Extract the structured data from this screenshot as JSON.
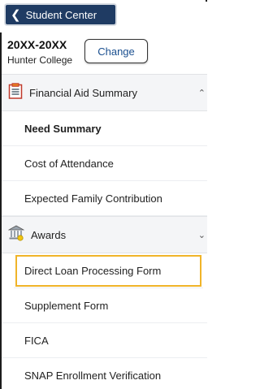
{
  "header": {
    "back_label": "Student Center"
  },
  "term": {
    "title": "20XX-20XX",
    "college": "Hunter College",
    "change_label": "Change"
  },
  "sections": [
    {
      "label": "Financial Aid Summary",
      "icon": "clipboard-icon",
      "expanded": true,
      "items": [
        {
          "label": "Need Summary",
          "selected": true
        },
        {
          "label": "Cost of Attendance"
        },
        {
          "label": "Expected Family Contribution"
        }
      ]
    },
    {
      "label": "Awards",
      "icon": "bank-icon",
      "expanded": true,
      "items": [
        {
          "label": "Direct Loan Processing Form",
          "highlighted": true
        },
        {
          "label": "Supplement Form"
        },
        {
          "label": "FICA"
        },
        {
          "label": "SNAP Enrollment Verification"
        }
      ]
    }
  ],
  "colors": {
    "back_button_bg": "#1f3b63",
    "highlight": "#f0b429",
    "change_text": "#1a4f8f"
  }
}
